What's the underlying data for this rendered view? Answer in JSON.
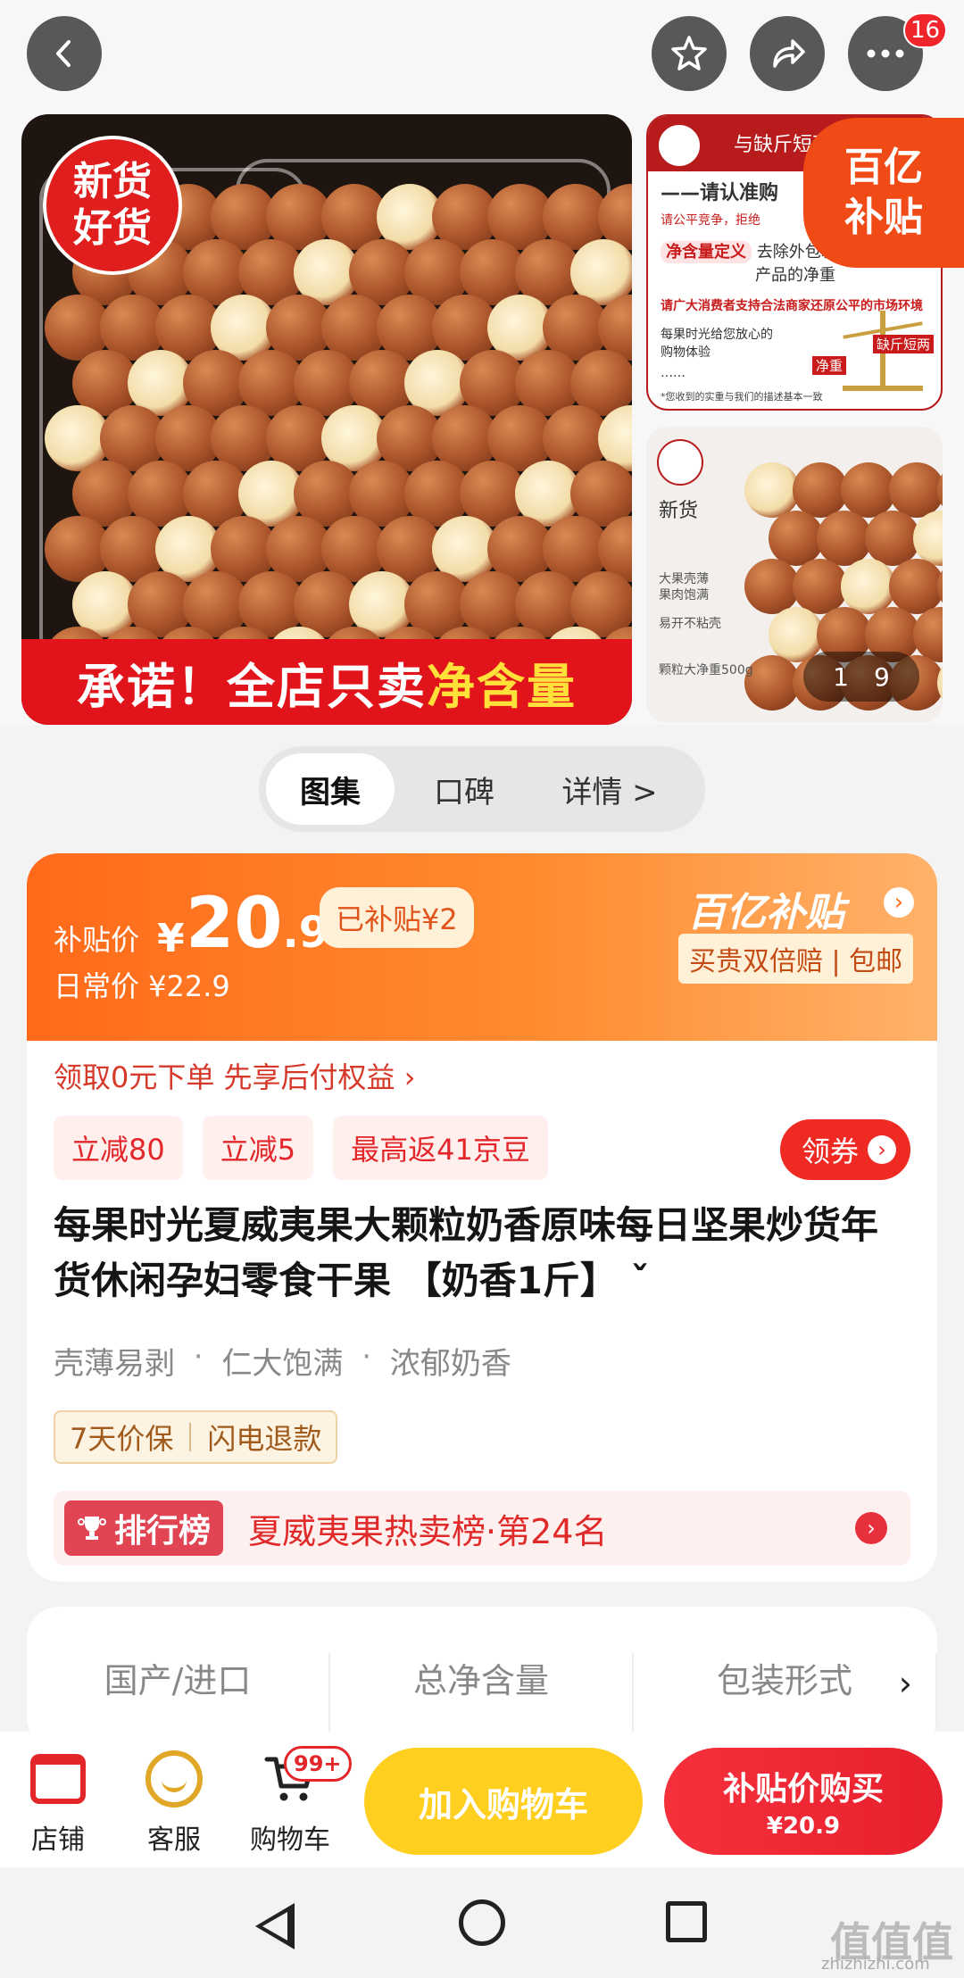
{
  "top": {
    "badge_count": "16"
  },
  "gallery": {
    "main_badge_line1": "新货",
    "main_badge_line2": "好货",
    "promise_prefix": "承诺！全店只卖",
    "promise_highlight": "净含量",
    "thumb1": {
      "header": "与缺斤短两",
      "line1": "——请认准购",
      "line2": "请公平竞争，拒绝",
      "line3_tag": "净含量定义",
      "line3_text": "去除外包装",
      "line3_text2": "产品的净重",
      "line4": "请广大消费者支持合法商家还原公平的市场环境",
      "line5": "每果时光给您放心的",
      "line6": "购物体验",
      "line7": "……",
      "label_left": "净重",
      "label_right": "缺斤短两",
      "footnote": "*您收到的实重与我们的描述基本一致"
    },
    "subsidy_line1": "百亿",
    "subsidy_line2": "补贴",
    "thumb2": {
      "title": "新货",
      "note1": "大果壳薄",
      "note2": "果肉饱满",
      "note3": "易开不粘壳",
      "note4": "颗粒大净重500g"
    },
    "counter_current": "1",
    "counter_total": "9"
  },
  "tabs": [
    "图集",
    "口碑",
    "详情 >"
  ],
  "price": {
    "label": "补贴价",
    "yen": "¥",
    "integer": "20",
    "decimal": ".9",
    "subsidized": "已补贴¥2",
    "daily": "日常价 ¥22.9",
    "program_title": "百亿补贴",
    "program_sub": "买贵双倍赔 | 包邮"
  },
  "credit_line": "领取0元下单 先享后付权益 ›",
  "coupons": [
    "立减80",
    "立减5",
    "最高返41京豆"
  ],
  "get_coupon": "领券",
  "product_title": "每果时光夏威夷果大颗粒奶香原味每日坚果炒货年货休闲孕妇零食干果 【奶香1斤】 ˇ",
  "features": [
    "壳薄易剥",
    "仁大饱满",
    "浓郁奶香"
  ],
  "guarantees": [
    "7天价保",
    "闪电退款"
  ],
  "rank": {
    "badge": "排行榜",
    "text": "夏威夷果热卖榜·第24名"
  },
  "specs": [
    "国产/进口",
    "总净含量",
    "包装形式"
  ],
  "spec_more": "›",
  "bottom": {
    "store": "店铺",
    "service": "客服",
    "cart": "购物车",
    "cart_badge": "99+",
    "add_cart": "加入购物车",
    "buy_line1": "补贴价购买",
    "buy_line2": "¥20.9"
  },
  "watermark": {
    "text": "值值值",
    "url": "zhizhizhi.com"
  },
  "colors": {
    "accent_red": "#e2262a",
    "accent_orange": "#ff6a1a",
    "accent_yellow": "#ffcf1f"
  }
}
